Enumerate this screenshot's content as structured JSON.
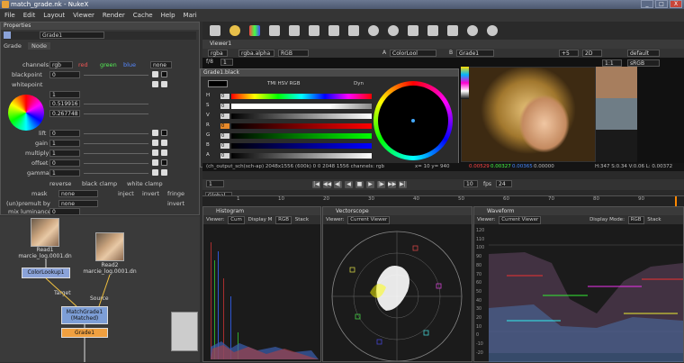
{
  "window": {
    "title": "match_grade.nk - NukeX",
    "controls": [
      "_",
      "□",
      "X"
    ]
  },
  "menu": [
    "File",
    "Edit",
    "Layout",
    "Viewer",
    "Render",
    "Cache",
    "Help",
    "Mari"
  ],
  "properties": {
    "panel_title": "Properties",
    "node_name": "Grade1",
    "tabs": [
      "Grade",
      "Node"
    ],
    "channels_label": "channels",
    "channels_value": "rgb",
    "channel_checks": [
      "red",
      "green",
      "blue"
    ],
    "channel_extra": "none",
    "rows": [
      {
        "label": "blackpoint",
        "value": "0"
      },
      {
        "label": "whitepoint",
        "value": "1"
      },
      {
        "label": "",
        "value": "0.519916"
      },
      {
        "label": "",
        "value": "0.267748"
      },
      {
        "label": "lift",
        "value": "0"
      },
      {
        "label": "gain",
        "value": "1"
      },
      {
        "label": "multiply",
        "value": "1"
      },
      {
        "label": "offset",
        "value": "0"
      },
      {
        "label": "gamma",
        "value": "1"
      }
    ],
    "checks": [
      "reverse",
      "black clamp",
      "white clamp"
    ],
    "mask_label": "mask",
    "mask_value": "none",
    "inject": "inject",
    "invert": "invert",
    "fringe": "fringe",
    "premult_label": "(un)premult by",
    "premult_value": "none",
    "invert2": "invert",
    "mix_label": "mix luminance",
    "mix_value": "0"
  },
  "nodes": {
    "read1": {
      "label": "Read1",
      "file": "marcie_log.0001.dn"
    },
    "read2": {
      "label": "Read2",
      "file": "marcie_log.0001.dn"
    },
    "colorlookup": "ColorLookup1",
    "matchgrade": "MatchGrade1\n(Matched)",
    "grade1": "Grade1",
    "target": "Target",
    "source": "Source"
  },
  "viewer": {
    "tab": "Viewer1",
    "channel1": "rgba",
    "channel2": "rgba.alpha",
    "channel3": "RGB",
    "input_a": "A",
    "colorlookup": "ColorLool",
    "input_b": "B",
    "grade": "Grade1",
    "gain_label": "f/8",
    "gain_value": "1",
    "ratio": "1:1",
    "zoom": "+5",
    "view": "2D",
    "lut": "default",
    "colorspace": "sRGB",
    "info": "(ch_output_sch(sch-ap) 2048x1556 (600k) 0 0 2048 1556 channels: rgb",
    "coords": "x= 10 y= 940",
    "pixel_vals": [
      "0.00529",
      "0.00327",
      "0.00365",
      "0.00000"
    ],
    "hsv": "H:347 S:0.34 V:0.06 L: 0.00372"
  },
  "grade_panel": {
    "title": "Grade1.black",
    "modes": "TMI HSV RGB",
    "dyn": "Dyn",
    "rows": [
      {
        "label": "H",
        "value": "0"
      },
      {
        "label": "S",
        "value": "0"
      },
      {
        "label": "V",
        "value": "0"
      },
      {
        "label": "R",
        "value": "0"
      },
      {
        "label": "G",
        "value": "0"
      },
      {
        "label": "B",
        "value": "0"
      },
      {
        "label": "A",
        "value": "0"
      }
    ]
  },
  "timeline": {
    "frame": "1",
    "fps_label": "fps",
    "fps_value": "24",
    "step": "10",
    "ruler_ticks": [
      "1",
      "10",
      "20",
      "30",
      "40",
      "50",
      "60",
      "70",
      "80",
      "90"
    ],
    "scope_sel": "Global"
  },
  "scopes": {
    "histogram": {
      "tab": "Histogram",
      "viewer_label": "Viewer:",
      "viewer_value": "Cum",
      "display_label": "Display M",
      "display_value": "RGB",
      "stack": "Stack"
    },
    "vectorscope": {
      "tab": "Vectorscope",
      "viewer_label": "Viewer:",
      "viewer_value": "Current Viewer"
    },
    "waveform": {
      "tab": "Waveform",
      "viewer_label": "Viewer:",
      "viewer_value": "Current Viewer",
      "display_label": "Display Mode:",
      "display_value": "RGB",
      "stack": "Stack",
      "yticks": [
        "120",
        "110",
        "100",
        "90",
        "80",
        "70",
        "60",
        "50",
        "40",
        "30",
        "20",
        "10",
        "0",
        "-10",
        "-20"
      ]
    }
  },
  "colors": {
    "accent": "#e8a23a",
    "node_blue": "#7d9ed6",
    "node_orange": "#f0a040",
    "node_purple": "#8aa2d8"
  }
}
